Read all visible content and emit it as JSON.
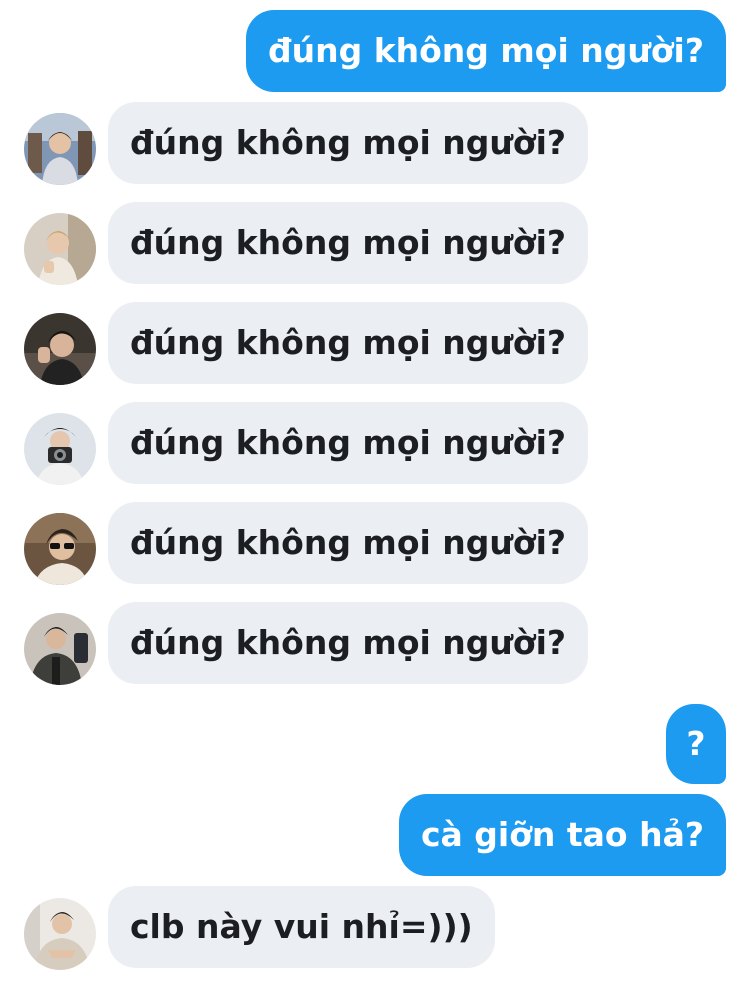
{
  "messages": [
    {
      "dir": "out",
      "text": "đúng không mọi người?"
    },
    {
      "dir": "in",
      "text": "đúng không mọi người?",
      "avatar": "avatar-photo-1"
    },
    {
      "dir": "in",
      "text": "đúng không mọi người?",
      "avatar": "avatar-photo-2"
    },
    {
      "dir": "in",
      "text": "đúng không mọi người?",
      "avatar": "avatar-photo-3"
    },
    {
      "dir": "in",
      "text": "đúng không mọi người?",
      "avatar": "avatar-photo-4"
    },
    {
      "dir": "in",
      "text": "đúng không mọi người?",
      "avatar": "avatar-photo-5"
    },
    {
      "dir": "in",
      "text": "đúng không mọi người?",
      "avatar": "avatar-photo-6"
    },
    {
      "dir": "out",
      "text": "?"
    },
    {
      "dir": "out",
      "text": "cà giỡn tao hả?"
    },
    {
      "dir": "in",
      "text": "clb này vui nhỉ=)))",
      "avatar": "avatar-photo-7"
    }
  ],
  "colors": {
    "sent_bubble": "#1d9bf0",
    "received_bubble": "#ebeef2",
    "received_text": "#1c1e21"
  }
}
